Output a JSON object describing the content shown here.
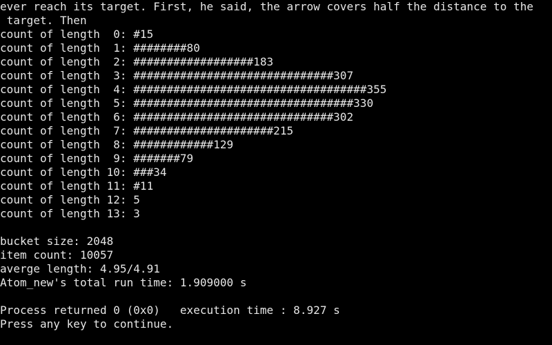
{
  "console": {
    "text_color": "#e6e6e6",
    "background_color": "#000000",
    "header_lines": [
      "ever reach its target. First, he said, the arrow covers half the distance to the",
      " target. Then"
    ],
    "histogram_lines": [
      "count of length  0: #15",
      "count of length  1: ########80",
      "count of length  2: ##################183",
      "count of length  3: ##############################307",
      "count of length  4: ###################################355",
      "count of length  5: #################################330",
      "count of length  6: ##############################302",
      "count of length  7: #####################215",
      "count of length  8: ############129",
      "count of length  9: #######79",
      "count of length 10: ###34",
      "count of length 11: #11",
      "count of length 12: 5",
      "count of length 13: 3"
    ],
    "stats_lines": [
      "bucket size: 2048",
      "item count: 10057",
      "averge length: 4.95/4.91",
      "Atom_new's total run time: 1.909000 s"
    ],
    "process_line": "Process returned 0 (0x0)   execution time : 8.927 s",
    "prompt_line": "Press any key to continue."
  }
}
